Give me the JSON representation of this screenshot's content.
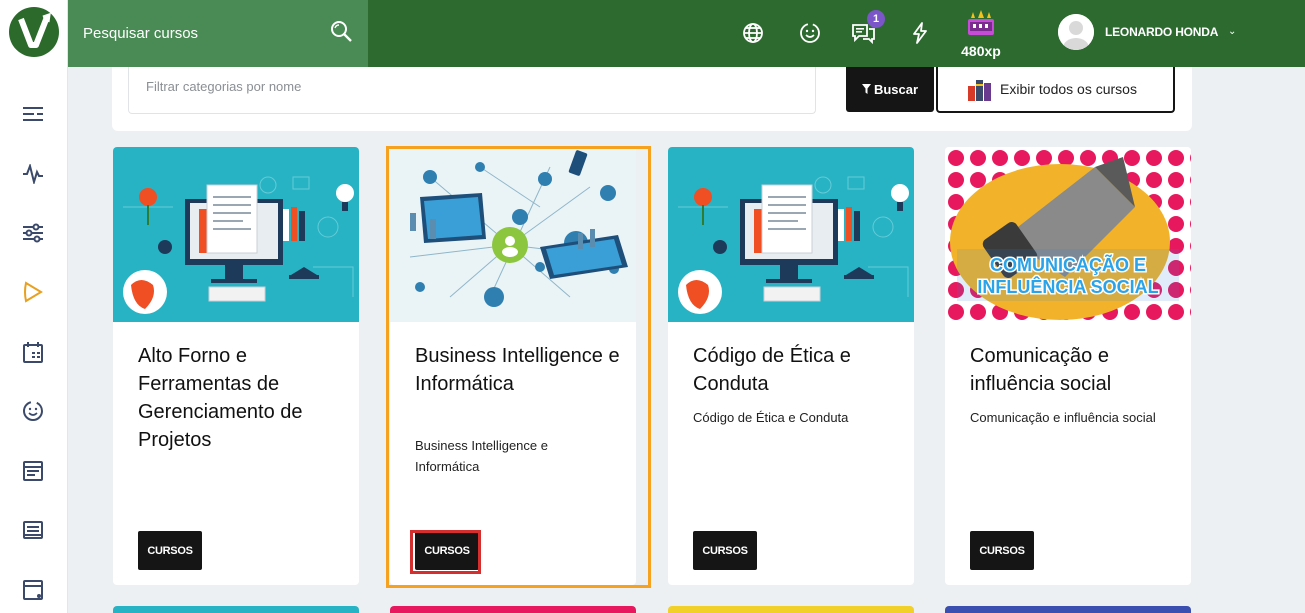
{
  "search": {
    "placeholder": "Pesquisar cursos"
  },
  "header": {
    "notifications_count": "1",
    "xp": "480xp",
    "user_name": "LEONARDO HONDA"
  },
  "filter": {
    "placeholder": "Filtrar categorias por nome",
    "buscar_label": "Buscar",
    "exibir_label": "Exibir todos os cursos"
  },
  "cards": [
    {
      "title": "Alto Forno e Ferramentas de Gerenciamento de Projetos",
      "subtitle": "",
      "tag": "CURSOS"
    },
    {
      "title": "Business Intelligence e Informática",
      "subtitle": "Business Intelligence e Informática",
      "tag": "CURSOS"
    },
    {
      "title": "Código de Ética e Conduta",
      "subtitle": "Código de Ética e Conduta",
      "tag": "CURSOS"
    },
    {
      "title": "Comunicação e influência social",
      "subtitle": "Comunicação e influência social",
      "tag": "CURSOS",
      "banner_text": "COMUNICAÇÃO E INFLUÊNCIA SOCIAL"
    }
  ],
  "colors": {
    "topbar": "#2d6a30",
    "search_bg": "#4a8a55",
    "accent_orange": "#f6a21e",
    "focus_red": "#d32f2f",
    "tag_bg": "#151515"
  }
}
